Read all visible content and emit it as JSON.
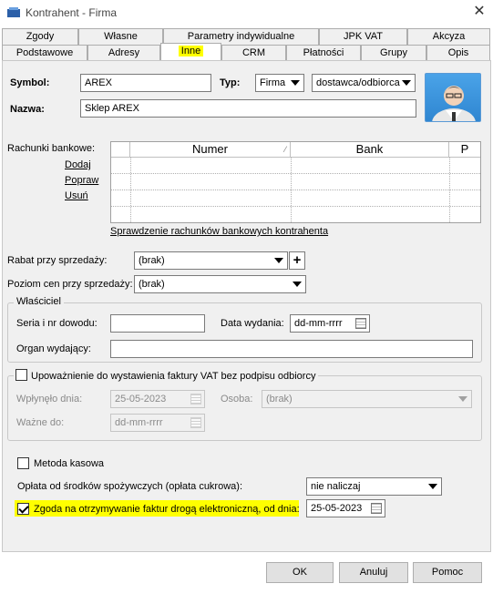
{
  "window": {
    "title": "Kontrahent - Firma",
    "close_glyph": "✕"
  },
  "tabs_row1": [
    "Zgody",
    "Własne",
    "Parametry indywidualne",
    "JPK VAT",
    "Akcyza"
  ],
  "tabs_row2": [
    "Podstawowe",
    "Adresy",
    "Inne",
    "CRM",
    "Płatności",
    "Grupy",
    "Opis"
  ],
  "active_tab": "Inne",
  "header": {
    "symbol_label": "Symbol:",
    "symbol_value": "AREX",
    "typ_label": "Typ:",
    "typ_value": "Firma",
    "role_value": "dostawca/odbiorca",
    "nazwa_label": "Nazwa:",
    "nazwa_value": "Sklep AREX"
  },
  "bank": {
    "label": "Rachunki bankowe:",
    "add": "Dodaj",
    "edit": "Popraw",
    "delete": "Usuń",
    "columns": [
      "Numer",
      "Bank",
      "P"
    ],
    "check_link": "Sprawdzenie rachunków bankowych kontrahenta"
  },
  "rabat": {
    "label": "Rabat przy sprzedaży:",
    "value": "(brak)",
    "plus": "+"
  },
  "poziom": {
    "label": "Poziom cen przy sprzedaży:",
    "value": "(brak)"
  },
  "wlasciciel": {
    "title": "Właściciel",
    "seria_label": "Seria i nr dowodu:",
    "seria_value": "",
    "data_label": "Data wydania:",
    "data_value": "dd-mm-rrrr",
    "organ_label": "Organ wydający:",
    "organ_value": ""
  },
  "upowaznienie": {
    "title": "Upoważnienie do wystawienia faktury VAT bez podpisu odbiorcy",
    "checked": false,
    "wplynelo_label": "Wpłynęło dnia:",
    "wplynelo_value": "25-05-2023",
    "osoba_label": "Osoba:",
    "osoba_value": "(brak)",
    "wazne_label": "Ważne do:",
    "wazne_value": "dd-mm-rrrr"
  },
  "metoda": {
    "label": "Metoda kasowa",
    "checked": false
  },
  "oplata": {
    "label": "Opłata od środków spożywczych (opłata cukrowa):",
    "value": "nie naliczaj"
  },
  "zgoda": {
    "label": "Zgoda na otrzymywanie faktur drogą elektroniczną, od dnia:",
    "checked": true,
    "date": "25-05-2023"
  },
  "buttons": {
    "ok": "OK",
    "cancel": "Anuluj",
    "help": "Pomoc"
  },
  "colors": {
    "highlight": "#ffff00",
    "panel": "#f0f0f0"
  }
}
